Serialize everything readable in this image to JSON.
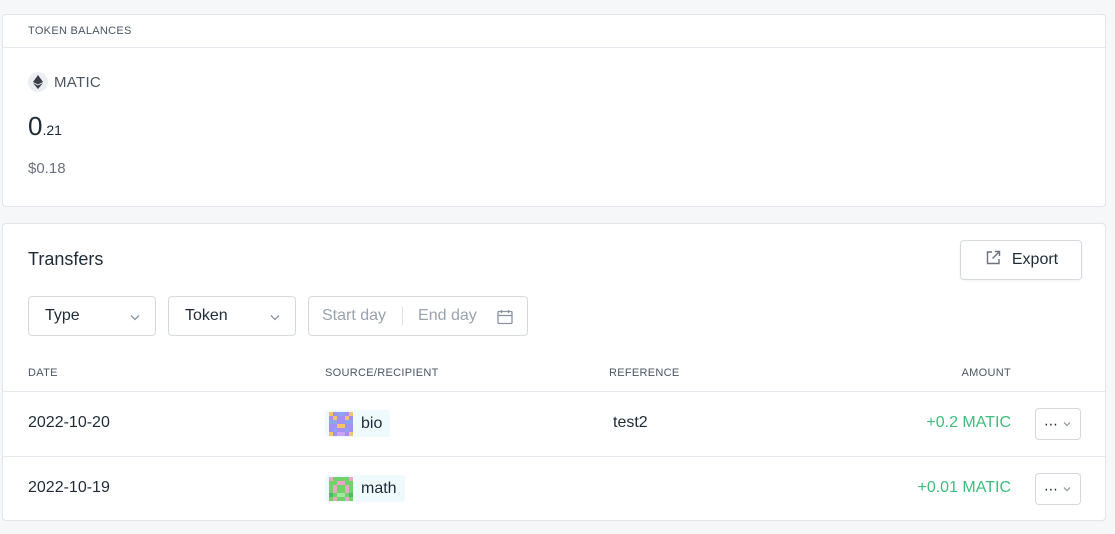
{
  "balances": {
    "header": "TOKEN BALANCES",
    "token_name": "MATIC",
    "token_icon": "ethereum-icon",
    "amount_int": "0",
    "amount_dec": ".21",
    "usd_value": "$0.18"
  },
  "transfers": {
    "title": "Transfers",
    "export_label": "Export",
    "filters": {
      "type_label": "Type",
      "token_label": "Token",
      "start_placeholder": "Start day",
      "end_placeholder": "End day"
    },
    "columns": {
      "date": "DATE",
      "source": "SOURCE/RECIPIENT",
      "reference": "REFERENCE",
      "amount": "AMOUNT"
    },
    "rows": [
      {
        "date": "2022-10-20",
        "recipient": "bio",
        "reference": "test2",
        "amount": "+0.2 MATIC"
      },
      {
        "date": "2022-10-19",
        "recipient": "math",
        "reference": "",
        "amount": "+0.01 MATIC"
      }
    ],
    "more_label": "⋯"
  },
  "colors": {
    "positive_amount": "#3dbd7d",
    "recipient_bg": "#eefafc",
    "border": "#d5d9df"
  }
}
